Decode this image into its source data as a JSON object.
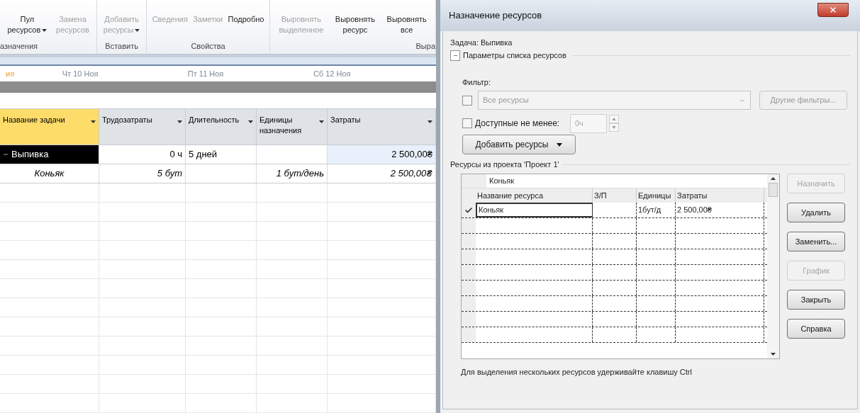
{
  "ribbon": {
    "buttons": [
      {
        "lines": [
          "Пул",
          "ресурсов"
        ],
        "disabled": false,
        "dropdown": true
      },
      {
        "lines": [
          "Замена",
          "ресурсов"
        ],
        "disabled": true,
        "dropdown": false
      },
      {
        "lines": [
          "Добавить",
          "ресурсы"
        ],
        "disabled": true,
        "dropdown": true
      },
      {
        "lines": [
          "Сведения"
        ],
        "disabled": true,
        "dropdown": false
      },
      {
        "lines": [
          "Заметки"
        ],
        "disabled": true,
        "dropdown": false
      },
      {
        "lines": [
          "Подробно"
        ],
        "disabled": false,
        "dropdown": false
      },
      {
        "lines": [
          "Выровнять",
          "выделенное"
        ],
        "disabled": true,
        "dropdown": false
      },
      {
        "lines": [
          "Выровнять",
          "ресурс"
        ],
        "disabled": false,
        "dropdown": false
      },
      {
        "lines": [
          "Выровнять",
          "все"
        ],
        "disabled": false,
        "dropdown": false
      }
    ],
    "groups": [
      "азначения",
      "Вставить",
      "Свойства",
      "Выра"
    ]
  },
  "timescale": [
    "ия",
    "Чт 10 Ноя",
    "Пт 11 Ноя",
    "Сб 12 Ноя"
  ],
  "table": {
    "columns": [
      {
        "label": "Название задачи",
        "selected": true
      },
      {
        "label": "Трудозатраты",
        "selected": false
      },
      {
        "label": "Длительность",
        "selected": false
      },
      {
        "label": "Единицы назначения",
        "selected": false
      },
      {
        "label": "Затраты",
        "selected": false
      }
    ],
    "rows": [
      {
        "kind": "summary",
        "expanded": true,
        "selected": true,
        "cells": [
          "Выпивка",
          "0 ч",
          "5 дней",
          "",
          "2 500,00₴"
        ]
      },
      {
        "kind": "assignment",
        "selected": false,
        "cells": [
          "Коньяк",
          "5 бут",
          "",
          "1 бут/день",
          "2 500,00₴"
        ]
      }
    ]
  },
  "dialog": {
    "title": "Назначение ресурсов",
    "task": "Задача: Выпивка",
    "options_label": "Параметры списка ресурсов",
    "options_expanded": true,
    "filter_label": "Фильтр:",
    "filter_checked": false,
    "filter_value": "Все ресурсы",
    "more_filters": "Другие фильтры...",
    "available_label": "Доступные не менее:",
    "available_checked": false,
    "available_value": "0ч",
    "add_button": "Добавить ресурсы",
    "resources_label": "Ресурсы из проекта 'Проект 1'",
    "edit_value": "Коньяк",
    "columns": [
      "Название ресурса",
      "З/П",
      "Единицы",
      "Затраты"
    ],
    "rows": [
      {
        "assigned": true,
        "cells": [
          "Коньяк",
          "",
          "1бут/д",
          "2 500,00₴"
        ]
      }
    ],
    "buttons": [
      {
        "label": "Назначить",
        "disabled": true
      },
      {
        "label": "Удалить",
        "disabled": false
      },
      {
        "label": "Заменить...",
        "disabled": false
      },
      {
        "label": "График",
        "disabled": true
      },
      {
        "label": "Закрыть",
        "disabled": false
      },
      {
        "label": "Справка",
        "disabled": false
      }
    ],
    "hint": "Для выделения нескольких ресурсов удерживайте клавишу Ctrl"
  }
}
